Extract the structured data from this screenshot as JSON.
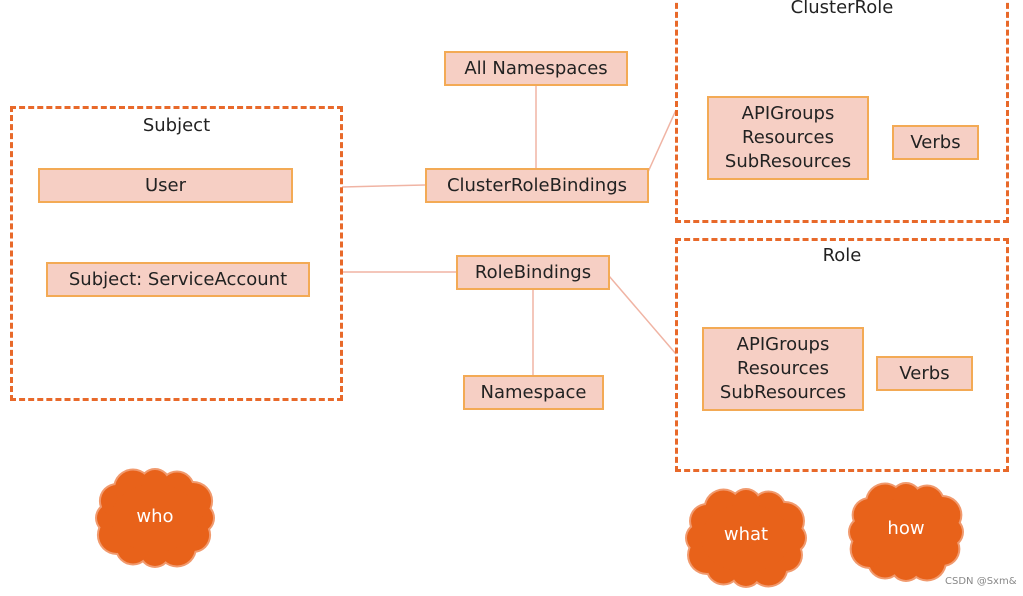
{
  "colors": {
    "dashed": "#e8692a",
    "box_fill": "#f6cfc4",
    "box_border": "#f3aa55",
    "connector": "#f0b4a4",
    "cloud": "#e8621a",
    "cloud_edge": "#f19a6e"
  },
  "subject": {
    "title": "Subject",
    "user": "User",
    "service_account": "Subject: ServiceAccount"
  },
  "bindings": {
    "all_namespaces": "All Namespaces",
    "cluster_role_bindings": "ClusterRoleBindings",
    "role_bindings": "RoleBindings",
    "namespace": "Namespace"
  },
  "cluster_role": {
    "title": "ClusterRole",
    "resources": [
      "APIGroups",
      "Resources",
      "SubResources"
    ],
    "verbs": "Verbs"
  },
  "role": {
    "title": "Role",
    "resources": [
      "APIGroups",
      "Resources",
      "SubResources"
    ],
    "verbs": "Verbs"
  },
  "clouds": {
    "who": "who",
    "what": "what",
    "how": "how"
  },
  "watermark": "CSDN @Sxm&"
}
